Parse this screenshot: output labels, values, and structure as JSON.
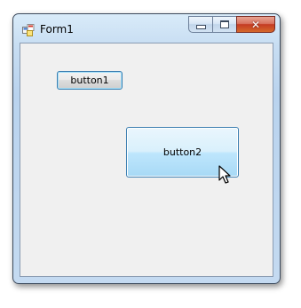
{
  "window": {
    "title": "Form1",
    "icon": "winforms-app-icon",
    "caption_buttons": {
      "minimize_icon": "minimize-icon",
      "maximize_icon": "maximize-icon",
      "close_glyph": "✕"
    }
  },
  "form": {
    "button1_label": "button1",
    "button2_label": "button2"
  },
  "cursor": {
    "icon": "arrow-cursor-icon"
  },
  "colors": {
    "client_background": "#f0f0f0",
    "button_border": "#3c7fb1",
    "close_button": "#c43b23"
  }
}
